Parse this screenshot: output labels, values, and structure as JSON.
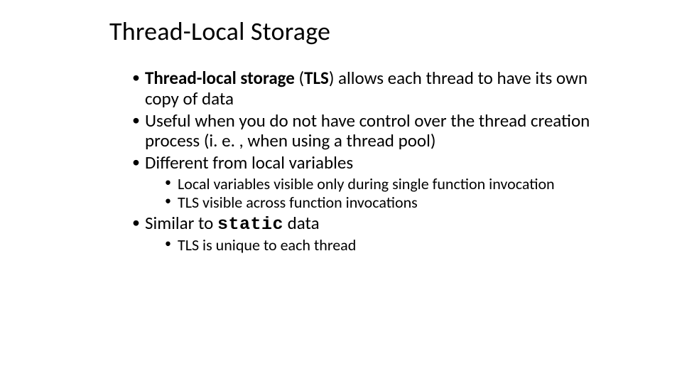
{
  "title": "Thread-Local Storage",
  "bullets": {
    "b1_strong1": "Thread-local storage",
    "b1_mid": " (",
    "b1_strong2": "TLS",
    "b1_rest": ") allows each thread to have its own copy of data",
    "b2": "Useful when you do not have control over the thread creation process (i. e. , when using a thread pool)",
    "b3": "Different from local variables",
    "b3_sub1": "Local variables visible only during single function invocation",
    "b3_sub2": "TLS visible across function invocations",
    "b4_pre": "Similar to ",
    "b4_mono": "static",
    "b4_post": " data",
    "b4_sub1": "TLS is unique to each thread"
  }
}
